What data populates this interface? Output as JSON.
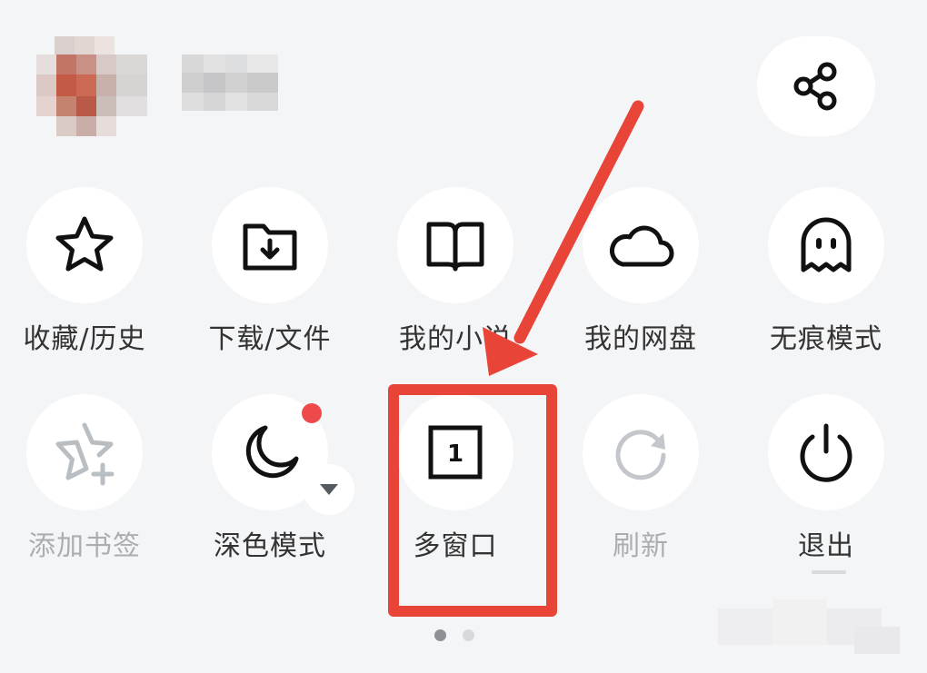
{
  "header": {
    "share_icon": "share-icon"
  },
  "menu": {
    "row1": [
      {
        "label": "收藏/历史",
        "icon": "star-icon",
        "enabled": true
      },
      {
        "label": "下载/文件",
        "icon": "download-folder-icon",
        "enabled": true
      },
      {
        "label": "我的小说",
        "icon": "book-icon",
        "enabled": true
      },
      {
        "label": "我的网盘",
        "icon": "cloud-icon",
        "enabled": true
      },
      {
        "label": "无痕模式",
        "icon": "ghost-icon",
        "enabled": true
      }
    ],
    "row2": [
      {
        "label": "添加书签",
        "icon": "star-plus-icon",
        "enabled": false
      },
      {
        "label": "深色模式",
        "icon": "moon-icon",
        "enabled": true,
        "badge": "red-dot"
      },
      {
        "label": "多窗口",
        "icon": "window-count-icon",
        "enabled": true,
        "count": "1"
      },
      {
        "label": "刷新",
        "icon": "refresh-icon",
        "enabled": false
      },
      {
        "label": "退出",
        "icon": "power-icon",
        "enabled": true
      }
    ]
  },
  "pagination": {
    "current": 1,
    "total": 2
  },
  "colors": {
    "background": "#f4f5f7",
    "annotation_red": "#e84438",
    "badge_red": "#ee4a4c",
    "text": "#333333",
    "disabled_text": "#a9aeb3"
  }
}
